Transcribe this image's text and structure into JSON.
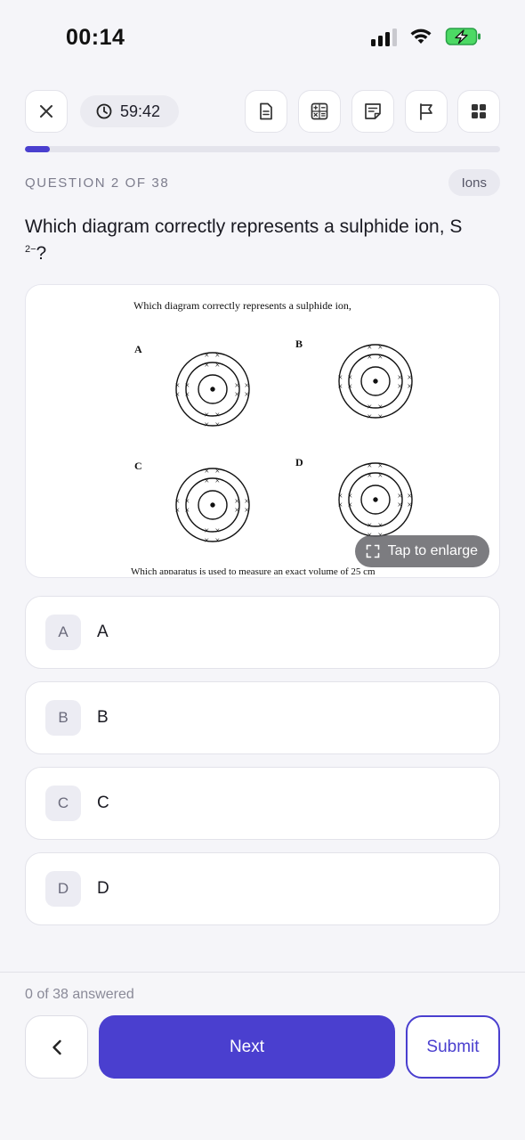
{
  "status_bar": {
    "time": "00:14",
    "icons": [
      "cellular-signal-icon",
      "wifi-icon",
      "battery-charging-icon"
    ],
    "battery_color": "#4cd964"
  },
  "toolbar": {
    "icons": [
      "close-icon",
      "clock-icon",
      "document-icon",
      "calculator-icon",
      "notes-icon",
      "flag-icon",
      "grid-icon"
    ],
    "timer": "59:42"
  },
  "progress": {
    "fraction": 0.053,
    "color": "#4a3fcf"
  },
  "question": {
    "counter": "QUESTION 2 OF 38",
    "topic": "Ions",
    "text_main": "Which diagram correctly represents a sulphide ion, S",
    "text_sup": "2−",
    "text_end": "?"
  },
  "image": {
    "scan_heading": "Which diagram correctly represents a sulphide ion,",
    "labels": [
      "A",
      "B",
      "C",
      "D"
    ],
    "scan_footer": "Which apparatus is used to measure an exact volume of 25 cm",
    "enlarge_label": "Tap to enlarge",
    "enlarge_icon": "expand-icon"
  },
  "options": [
    {
      "letter": "A",
      "text": "A"
    },
    {
      "letter": "B",
      "text": "B"
    },
    {
      "letter": "C",
      "text": "C"
    },
    {
      "letter": "D",
      "text": "D"
    }
  ],
  "footer": {
    "answered": "0 of 38 answered",
    "back_icon": "chevron-left-icon",
    "next_label": "Next",
    "submit_label": "Submit"
  }
}
